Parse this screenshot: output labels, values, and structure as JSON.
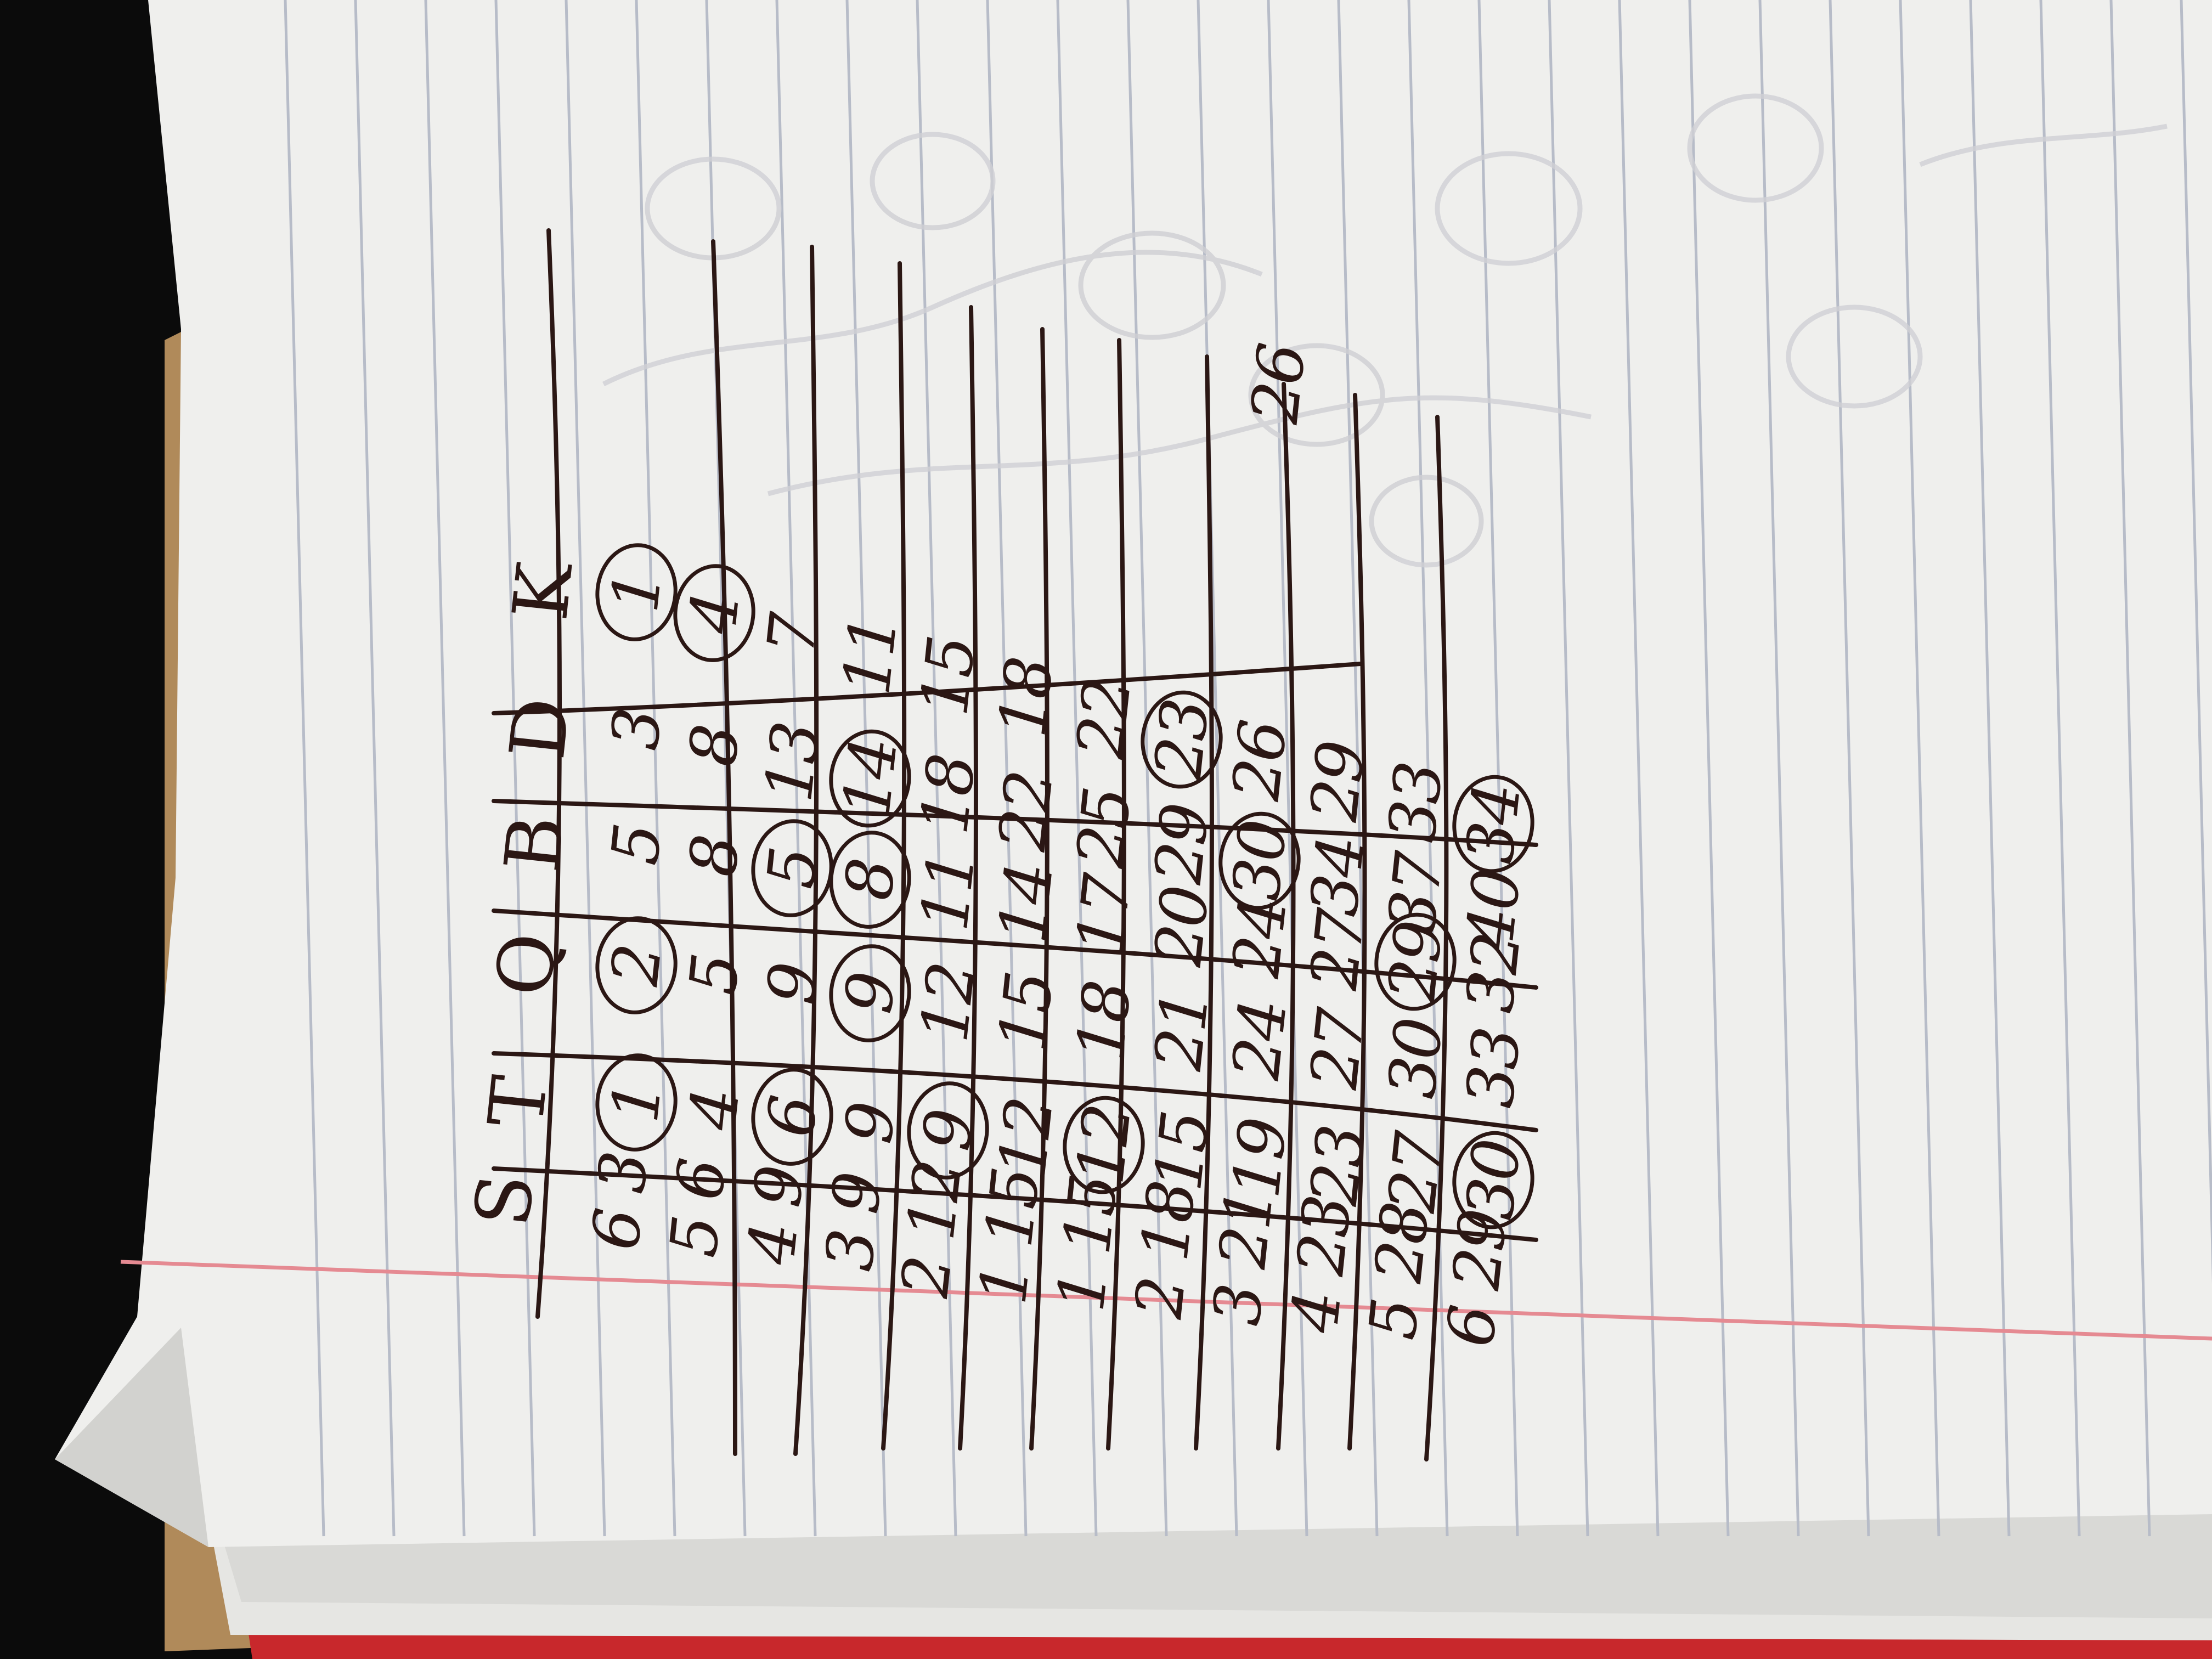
{
  "colors": {
    "ink": "#2b1714",
    "paper": "#f1f1ef",
    "paper_shadow": "#dcdcda",
    "rule_line": "#b7bcc8",
    "margin_line": "#e58a92",
    "cardboard": "#b08a5a",
    "red_folder": "#c8282c",
    "background": "#0b0b0b"
  },
  "table": {
    "header": [
      "S",
      "T",
      "Q",
      "B",
      "D",
      "K"
    ],
    "rows": [
      [
        {
          "t": "6 3",
          "c": false
        },
        {
          "t": "1",
          "c": true
        },
        {
          "t": "2",
          "c": true
        },
        {
          "t": "5",
          "c": false
        },
        {
          "t": "3",
          "c": false
        },
        {
          "t": "1",
          "c": true
        }
      ],
      [
        {
          "t": "5 6",
          "c": false
        },
        {
          "t": "4",
          "c": false
        },
        {
          "t": "5",
          "c": false
        },
        {
          "t": "8",
          "c": false
        },
        {
          "t": "8",
          "c": false
        },
        {
          "t": "4",
          "c": true
        }
      ],
      [
        {
          "t": "4 9",
          "c": false
        },
        {
          "t": "6",
          "c": true
        },
        {
          "t": "9",
          "c": false
        },
        {
          "t": "5",
          "c": true
        },
        {
          "t": "13",
          "c": false
        },
        {
          "t": "7",
          "c": false
        }
      ],
      [
        {
          "t": "3 9",
          "c": false
        },
        {
          "t": "9",
          "c": false
        },
        {
          "t": "9",
          "c": true
        },
        {
          "t": "8",
          "c": true
        },
        {
          "t": "14",
          "c": true
        },
        {
          "t": "11",
          "c": false
        }
      ],
      [
        {
          "t": "2 12",
          "c": false
        },
        {
          "t": "9",
          "c": true
        },
        {
          "t": "12",
          "c": false
        },
        {
          "t": "11",
          "c": false
        },
        {
          "t": "18",
          "c": false
        },
        {
          "t": "15",
          "c": false
        }
      ],
      [
        {
          "t": "1 15",
          "c": false
        },
        {
          "t": "12",
          "c": false
        },
        {
          "t": "15",
          "c": false
        },
        {
          "t": "14",
          "c": false
        },
        {
          "t": "22",
          "c": false
        },
        {
          "t": "18",
          "c": false
        }
      ],
      [
        {
          "t": "1 15",
          "c": false
        },
        {
          "t": "12",
          "c": true
        },
        {
          "t": "18",
          "c": false
        },
        {
          "t": "17",
          "c": false
        },
        {
          "t": "25",
          "c": false
        },
        {
          "t": "22",
          "c": false
        }
      ],
      [
        {
          "t": "2 18",
          "c": false
        },
        {
          "t": "15",
          "c": false
        },
        {
          "t": "21",
          "c": false
        },
        {
          "t": "20",
          "c": false
        },
        {
          "t": "29",
          "c": false
        },
        {
          "t": "23",
          "c": true
        }
      ],
      [
        {
          "t": "3 21",
          "c": false
        },
        {
          "t": "19",
          "c": false
        },
        {
          "t": "24",
          "c": false
        },
        {
          "t": "24",
          "c": false
        },
        {
          "t": "30",
          "c": true
        },
        {
          "t": "26",
          "c": false
        }
      ],
      [
        {
          "t": "4 23",
          "c": false
        },
        {
          "t": "23",
          "c": false
        },
        {
          "t": "27",
          "c": false
        },
        {
          "t": "27",
          "c": false
        },
        {
          "t": "34",
          "c": false
        },
        {
          "t": "29",
          "c": false
        }
      ],
      [
        {
          "t": "5 28",
          "c": false
        },
        {
          "t": "27",
          "c": false
        },
        {
          "t": "30",
          "c": false
        },
        {
          "t": "29",
          "c": true
        },
        {
          "t": "37",
          "c": false
        },
        {
          "t": "33",
          "c": false
        }
      ],
      [
        {
          "t": "6 29",
          "c": false
        },
        {
          "t": "30",
          "c": true
        },
        {
          "t": "33",
          "c": false
        },
        {
          "t": "32",
          "c": false
        },
        {
          "t": "40",
          "c": false
        },
        {
          "t": "34",
          "c": true
        }
      ]
    ],
    "side_note": {
      "t": "26",
      "c": false
    }
  }
}
